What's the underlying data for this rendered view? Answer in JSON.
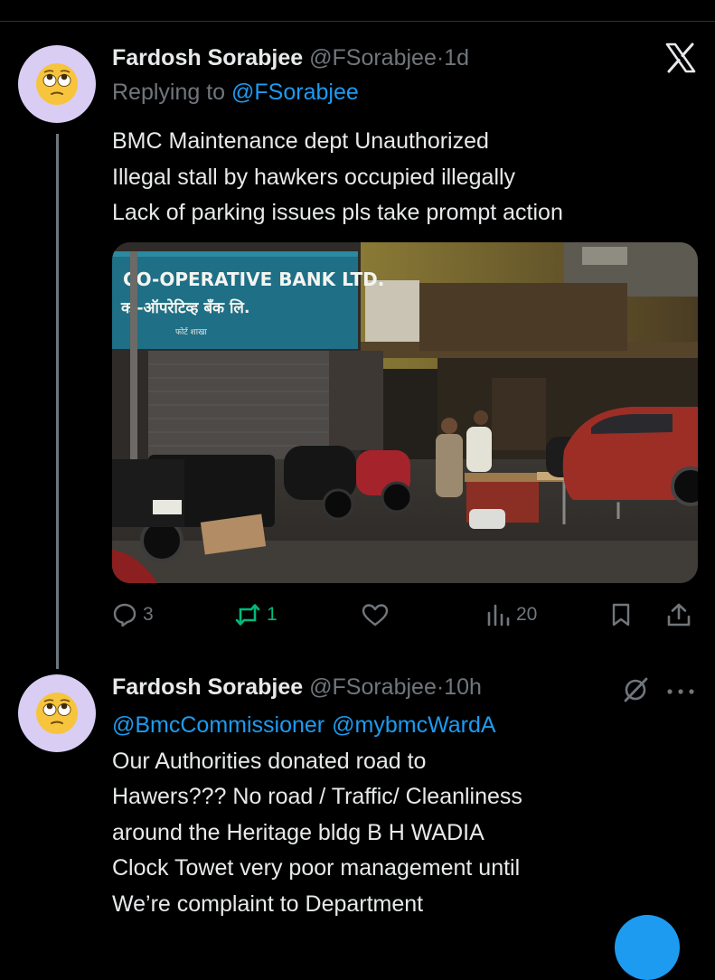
{
  "tweet1": {
    "author_name": "Fardosh Sorabjee",
    "author_handle": "@FSorabjee",
    "separator": "·",
    "time": "1d",
    "replying_prefix": "Replying to",
    "replying_handle": "@FSorabjee",
    "text_lines": [
      "BMC Maintenance dept Unauthorized",
      "Illegal stall by hawkers occupied illegally",
      "Lack of parking issues pls take prompt action"
    ],
    "photo": {
      "sign_line1": "CO-OPERATIVE BANK LTD.",
      "sign_line2": "को-ऑपरेटिव्ह बँक लि.",
      "sign_line3": "फोर्ट शाखा"
    },
    "actions": {
      "replies": "3",
      "reposts": "1",
      "views": "20"
    }
  },
  "tweet2": {
    "author_name": "Fardosh Sorabjee",
    "author_handle": "@FSorabjee",
    "separator": "·",
    "time": "10h",
    "mentions": [
      "@BmcCommissioner",
      "@mybmcWardA"
    ],
    "text_lines": [
      "Our Authorities donated road to",
      "Hawers??? No road / Traffic/ Cleanliness",
      "around the Heritage bldg B H WADIA",
      "Clock Towet very poor management until",
      "We’re complaint to Department"
    ]
  },
  "icons": {
    "close": "x-logo-icon",
    "reply": "reply-icon",
    "repost": "repost-icon",
    "like": "like-icon",
    "views": "views-icon",
    "bookmark": "bookmark-icon",
    "share": "share-icon",
    "grok": "grok-icon",
    "more": "more-icon"
  },
  "colors": {
    "background": "#000000",
    "text": "#e7e9ea",
    "secondary": "#71767b",
    "link": "#1d9bf0",
    "repost_green": "#00ba7c",
    "avatar_bg": "#d9cdf4"
  }
}
